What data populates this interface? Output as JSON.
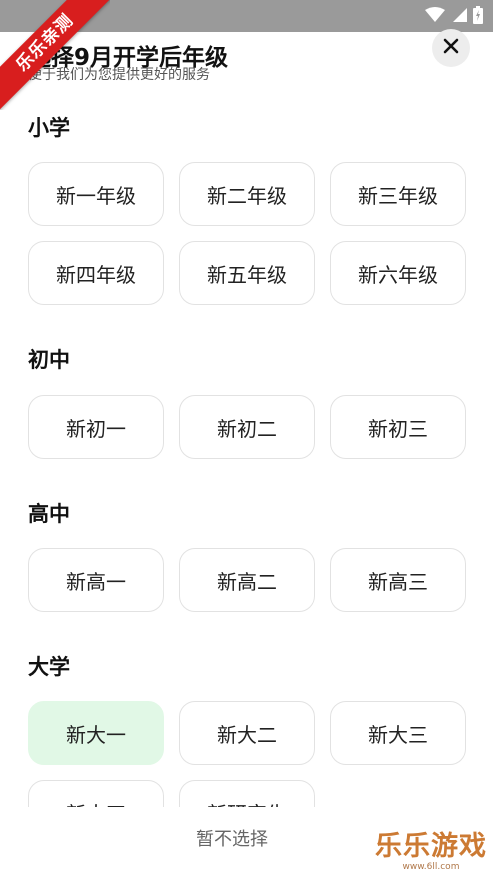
{
  "header": {
    "title": "选择9月开学后年级",
    "subtitle": "便于我们为您提供更好的服务"
  },
  "icons": {
    "close": "close-icon",
    "wifi": "wifi-icon",
    "signal": "signal-icon",
    "battery": "battery-icon"
  },
  "sections": [
    {
      "title": "小学",
      "options": [
        "新一年级",
        "新二年级",
        "新三年级",
        "新四年级",
        "新五年级",
        "新六年级"
      ]
    },
    {
      "title": "初中",
      "options": [
        "新初一",
        "新初二",
        "新初三"
      ]
    },
    {
      "title": "高中",
      "options": [
        "新高一",
        "新高二",
        "新高三"
      ]
    },
    {
      "title": "大学",
      "options": [
        "新大一",
        "新大二",
        "新大三",
        "新大四",
        "新研究生"
      ],
      "selected": "新大一"
    }
  ],
  "footer": {
    "skip_label": "暂不选择"
  },
  "watermark": {
    "ribbon": "乐乐亲测",
    "title": "乐乐游戏",
    "url": "www.6ll.com"
  },
  "colors": {
    "selected_bg": "#e1f8e6",
    "ribbon": "#d81e1e",
    "statusbar": "#9a9a9a"
  }
}
